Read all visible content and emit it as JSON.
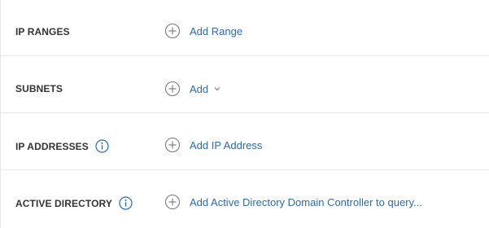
{
  "sections": [
    {
      "title": "IP RANGES",
      "action": "Add Range"
    },
    {
      "title": "SUBNETS",
      "action": "Add"
    },
    {
      "title": "IP ADDRESSES",
      "action": "Add IP Address"
    },
    {
      "title": "ACTIVE DIRECTORY",
      "action": "Add Active Directory Domain Controller to query..."
    }
  ],
  "colors": {
    "link": "#2e6aa0",
    "icon_gray": "#777777",
    "info_blue": "#2e6aa0",
    "divider": "#e8e8e8"
  },
  "icons": {
    "add": "plus-circle-icon",
    "info": "info-icon",
    "dropdown": "chevron-down-icon"
  }
}
